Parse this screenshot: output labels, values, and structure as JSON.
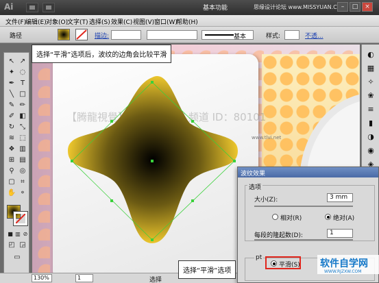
{
  "titlebar": {
    "logo": "Ai",
    "workspace": "基本功能",
    "watermark": "思缘设计论坛 www.MISSYUAN.COM",
    "minimize": "–",
    "maximize": "□",
    "close": "×"
  },
  "menu": [
    "文件(F)",
    "编辑(E)",
    "对象(O)",
    "文字(T)",
    "选择(S)",
    "效果(C)",
    "视图(V)",
    "窗口(W)",
    "帮助(H)"
  ],
  "control": {
    "object_type": "路径",
    "stroke_label": "描边:",
    "stroke_style": "基本",
    "style_label": "样式:",
    "opacity_link": "不透..."
  },
  "callouts": {
    "top": "选择“平滑”选项后，波纹的边角会比较平滑",
    "bottom": "选择“平滑”选项"
  },
  "canvas": {
    "watermark": "【腾龍視覺】设计学院  YY 频道 ID：80101",
    "small_url": "www.tlvi.net"
  },
  "dialog": {
    "title": "波纹效果",
    "options_group": "选项",
    "size_label": "大小(Z):",
    "size_value": "3 mm",
    "relative_label": "相对(R)",
    "absolute_label": "绝对(A)",
    "ridges_label": "每段的隆起数(D):",
    "ridges_value": "1",
    "points_group": "pt",
    "smooth_label": "平滑(S)"
  },
  "status": {
    "zoom": "130%",
    "page": "1",
    "tool": "选择"
  },
  "site_logo": {
    "text": "软件自学网",
    "url": "WWW.RJZXW.COM"
  },
  "colors": {
    "accent": "#e0261d",
    "shape_gradient_center": "#000000",
    "shape_gradient_edge": "#e8c22a",
    "path_selection": "#3ad13a"
  }
}
